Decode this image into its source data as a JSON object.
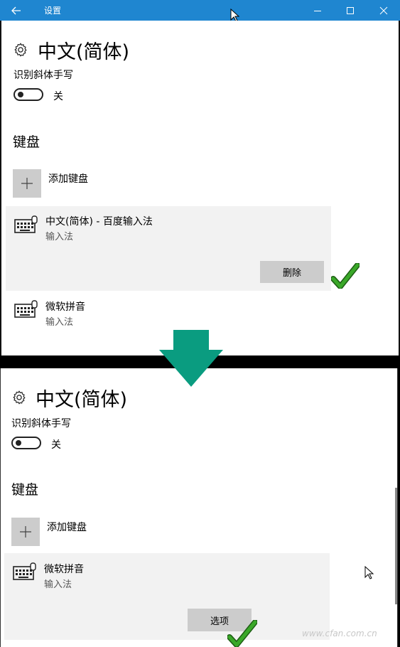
{
  "window_top": {
    "title": "设置",
    "page_title": "中文(简体)",
    "handwriting_label": "识别斜体手写",
    "toggle_state": "关",
    "keyboard_section": "键盘",
    "add_keyboard": "添加键盘",
    "keyboards": [
      {
        "name": "中文(简体) - 百度输入法",
        "type": "输入法",
        "action": "删除"
      },
      {
        "name": "微软拼音",
        "type": "输入法"
      }
    ]
  },
  "window_bottom": {
    "page_title": "中文(简体)",
    "handwriting_label": "识别斜体手写",
    "toggle_state": "关",
    "keyboard_section": "键盘",
    "add_keyboard": "添加键盘",
    "keyboards": [
      {
        "name": "微软拼音",
        "type": "输入法",
        "action": "选项"
      }
    ]
  },
  "watermark": "www.cfan.com.cn",
  "colors": {
    "titlebar": "#1f86d0",
    "arrow": "#0a9c80",
    "check": "#3aa829"
  }
}
